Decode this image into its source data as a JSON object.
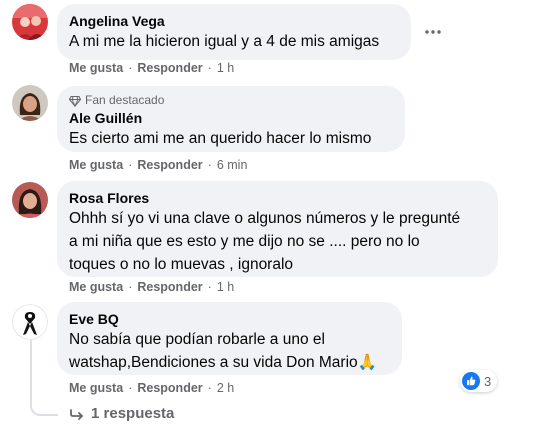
{
  "comments": [
    {
      "author": "Angelina Vega",
      "text": "A mi me la hicieron igual y a 4 de mis amigas",
      "like_label": "Me gusta",
      "reply_label": "Responder",
      "time": "1 h",
      "avatar_icon": "person-avatar-red"
    },
    {
      "badge": "Fan destacado",
      "badge_icon": "diamond-icon",
      "author": "Ale Guillén",
      "text": "Es cierto ami me an querido hacer lo mismo",
      "like_label": "Me gusta",
      "reply_label": "Responder",
      "time": "6 min",
      "avatar_icon": "person-avatar-woman"
    },
    {
      "author": "Rosa Flores",
      "text_lines": [
        "Ohhh sí yo vi una clave o algunos números y le pregunté",
        "a mi niña que es esto y me dijo no se .... pero no lo",
        "toques o no lo muevas , ignoralo"
      ],
      "like_label": "Me gusta",
      "reply_label": "Responder",
      "time": "1 h",
      "avatar_icon": "person-avatar-woman-2"
    },
    {
      "author": "Eve BQ",
      "text_lines": [
        "No sabía que podían robarle a uno el",
        "watshap,Bendiciones a su vida Don Mario🙏"
      ],
      "like_label": "Me gusta",
      "reply_label": "Responder",
      "time": "2 h",
      "avatar_icon": "black-ribbon-avatar",
      "reaction_count": "3",
      "reaction_icon": "like-icon"
    }
  ],
  "replies_link": "1 respuesta",
  "colors": {
    "bubble": "#f0f2f5",
    "meta": "#65676b",
    "like_blue": "#1877f2"
  }
}
